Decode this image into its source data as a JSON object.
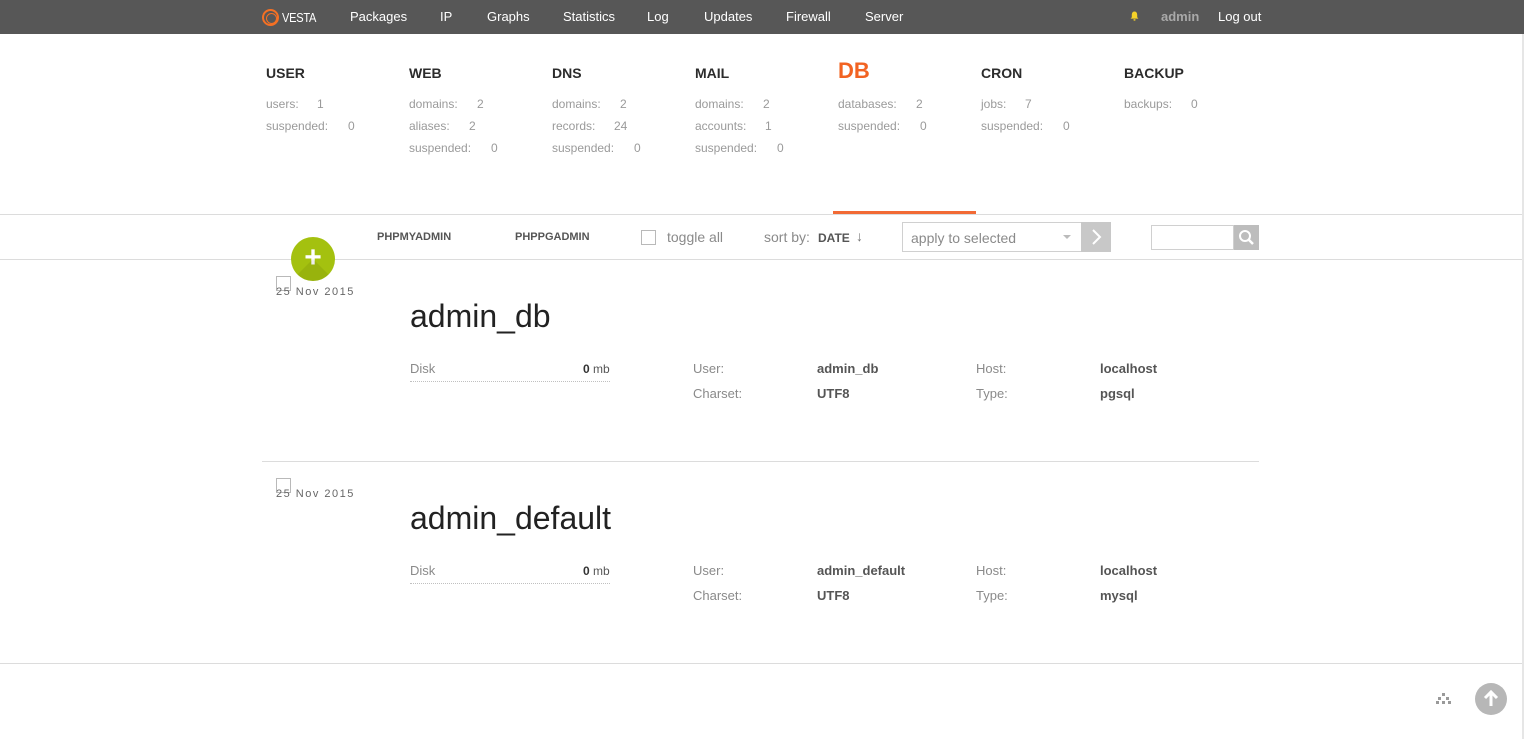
{
  "topbar": {
    "brand": "VESTA",
    "nav": [
      "Packages",
      "IP",
      "Graphs",
      "Statistics",
      "Log",
      "Updates",
      "Firewall",
      "Server"
    ],
    "user": "admin",
    "logout": "Log out"
  },
  "stats": {
    "user": {
      "title": "USER",
      "rows": [
        {
          "label": "users:",
          "value": "1"
        },
        {
          "label": "suspended:",
          "value": "0"
        }
      ]
    },
    "web": {
      "title": "WEB",
      "rows": [
        {
          "label": "domains:",
          "value": "2"
        },
        {
          "label": "aliases:",
          "value": "2"
        },
        {
          "label": "suspended:",
          "value": "0"
        }
      ]
    },
    "dns": {
      "title": "DNS",
      "rows": [
        {
          "label": "domains:",
          "value": "2"
        },
        {
          "label": "records:",
          "value": "24"
        },
        {
          "label": "suspended:",
          "value": "0"
        }
      ]
    },
    "mail": {
      "title": "MAIL",
      "rows": [
        {
          "label": "domains:",
          "value": "2"
        },
        {
          "label": "accounts:",
          "value": "1"
        },
        {
          "label": "suspended:",
          "value": "0"
        }
      ]
    },
    "db": {
      "title": "DB",
      "rows": [
        {
          "label": "databases:",
          "value": "2"
        },
        {
          "label": "suspended:",
          "value": "0"
        }
      ]
    },
    "cron": {
      "title": "CRON",
      "rows": [
        {
          "label": "jobs:",
          "value": "7"
        },
        {
          "label": "suspended:",
          "value": "0"
        }
      ]
    },
    "backup": {
      "title": "BACKUP",
      "rows": [
        {
          "label": "backups:",
          "value": "0"
        }
      ]
    }
  },
  "toolbar": {
    "add_symbol": "+",
    "phpmyadmin": "PHPMYADMIN",
    "phppgadmin": "PHPPGADMIN",
    "toggle_all": "toggle all",
    "sort_by": "sort by:",
    "sort_value": "DATE",
    "sort_arrow": "↓",
    "apply_select": "apply to selected",
    "apply_arrow": "›"
  },
  "databases": [
    {
      "date": "25 Nov 2015",
      "name": "admin_db",
      "disk_label": "Disk",
      "disk_value": "0",
      "disk_unit": "mb",
      "user_label": "User:",
      "user": "admin_db",
      "charset_label": "Charset:",
      "charset": "UTF8",
      "host_label": "Host:",
      "host": "localhost",
      "type_label": "Type:",
      "type": "pgsql"
    },
    {
      "date": "25 Nov 2015",
      "name": "admin_default",
      "disk_label": "Disk",
      "disk_value": "0",
      "disk_unit": "mb",
      "user_label": "User:",
      "user": "admin_default",
      "charset_label": "Charset:",
      "charset": "UTF8",
      "host_label": "Host:",
      "host": "localhost",
      "type_label": "Type:",
      "type": "mysql"
    }
  ],
  "colors": {
    "topbar": "#575757",
    "accent": "#f26322",
    "add_button": "#a4c10f"
  }
}
